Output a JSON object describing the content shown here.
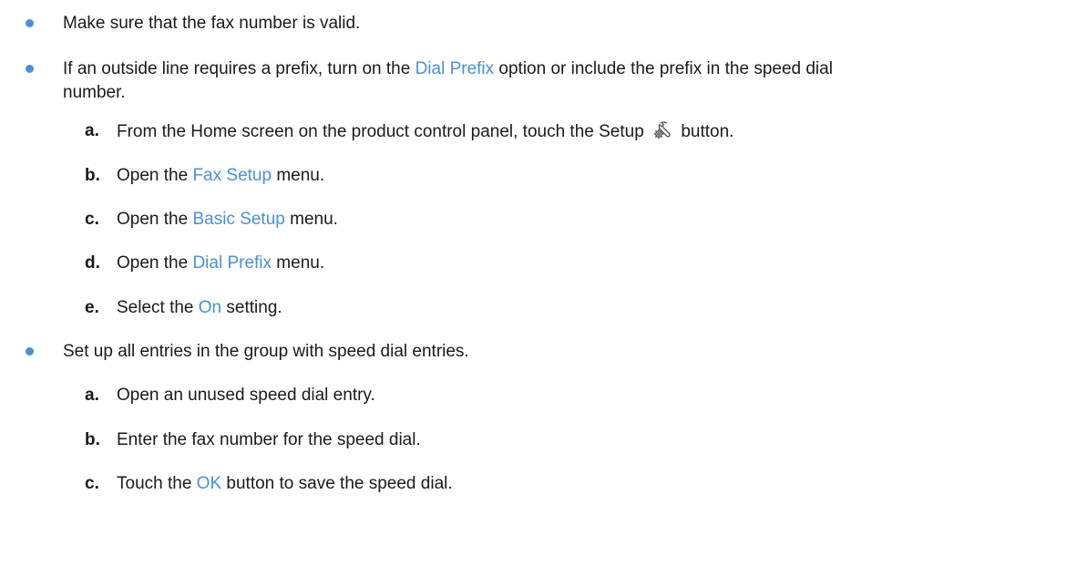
{
  "colors": {
    "accent": "#4a90d9",
    "text": "#1a1a1a"
  },
  "bullets": [
    {
      "text": "Make sure that the fax number is valid."
    },
    {
      "line1_pre": "If an outside line requires a prefix, turn on the ",
      "line1_link": "Dial Prefix",
      "line1_post": " option or include the prefix in the speed dial",
      "line2": "number.",
      "steps": [
        {
          "letter": "a.",
          "pre": "From the Home screen on the product control panel, touch the Setup ",
          "icon": "setup-wrench-gear-icon",
          "post": " button."
        },
        {
          "letter": "b.",
          "pre": "Open the ",
          "link": "Fax Setup",
          "post": " menu."
        },
        {
          "letter": "c.",
          "pre": "Open the ",
          "link": "Basic Setup",
          "post": " menu."
        },
        {
          "letter": "d.",
          "pre": "Open the ",
          "link": "Dial Prefix",
          "post": " menu."
        },
        {
          "letter": "e.",
          "pre": "Select the ",
          "link": "On",
          "post": " setting."
        }
      ]
    },
    {
      "text": "Set up all entries in the group with speed dial entries.",
      "steps": [
        {
          "letter": "a.",
          "text": "Open an unused speed dial entry."
        },
        {
          "letter": "b.",
          "text": "Enter the fax number for the speed dial."
        },
        {
          "letter": "c.",
          "pre": "Touch the ",
          "link": "OK",
          "post": " button to save the speed dial."
        }
      ]
    }
  ]
}
